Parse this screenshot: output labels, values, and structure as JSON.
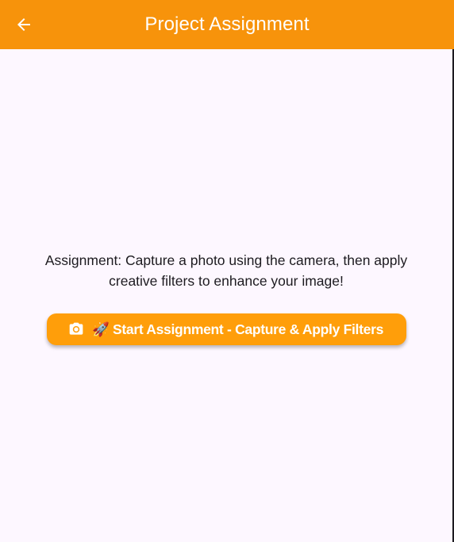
{
  "app_bar": {
    "title": "Project Assignment",
    "background": "#f7930b",
    "back_icon": "arrow-back-icon"
  },
  "main": {
    "instruction": "Assignment: Capture a photo using the camera, then apply creative filters to enhance your image!",
    "start_button": {
      "icon": "camera-icon",
      "label": "🚀 Start Assignment - Capture & Apply Filters",
      "background": "#ff9e0a"
    }
  }
}
